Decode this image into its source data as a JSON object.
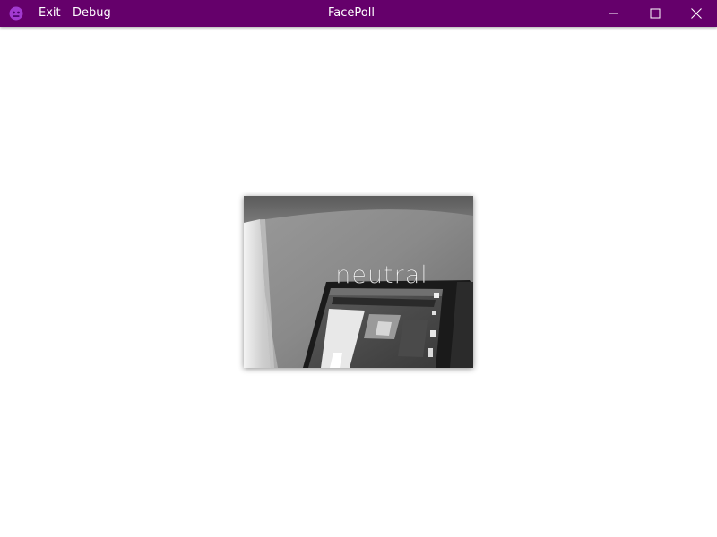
{
  "window": {
    "title": "FacePoll",
    "accent_color": "#65006b",
    "icon": "app-face-icon"
  },
  "menu": {
    "exit_label": "Exit",
    "debug_label": "Debug"
  },
  "window_controls": {
    "minimize_icon": "minimize-icon",
    "maximize_icon": "maximize-icon",
    "close_icon": "close-icon"
  },
  "camera": {
    "emotion_label": "neutral"
  }
}
